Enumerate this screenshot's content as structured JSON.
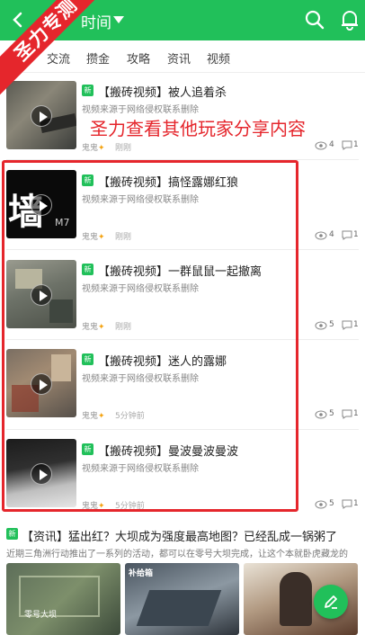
{
  "header": {
    "title": "时间"
  },
  "badge": {
    "text": "圣力专测"
  },
  "tabs": [
    {
      "label": "交流"
    },
    {
      "label": "攒金"
    },
    {
      "label": "攻略"
    },
    {
      "label": "资讯"
    },
    {
      "label": "视频"
    }
  ],
  "overlay": {
    "text": "圣力查看其他玩家分享内容"
  },
  "posts": [
    {
      "tag": "新",
      "title": "【搬砖视频】被人追着杀",
      "desc": "视频来源于网络侵权联系删除",
      "author": "鬼鬼",
      "time": "刚刚",
      "views": "4",
      "comments": "1"
    },
    {
      "tag": "新",
      "title": "【搬砖视频】搞怪露娜红狼",
      "desc": "视频来源于网络侵权联系删除",
      "author": "鬼鬼",
      "time": "刚刚",
      "views": "4",
      "comments": "1",
      "thumb_text": "墙",
      "thumb_text2": "M7"
    },
    {
      "tag": "新",
      "title": "【搬砖视频】一群鼠鼠一起撤离",
      "desc": "视频来源于网络侵权联系删除",
      "author": "鬼鬼",
      "time": "刚刚",
      "views": "5",
      "comments": "1"
    },
    {
      "tag": "新",
      "title": "【搬砖视频】迷人的露娜",
      "desc": "视频来源于网络侵权联系删除",
      "author": "鬼鬼",
      "time": "5分钟前",
      "views": "5",
      "comments": "1"
    },
    {
      "tag": "新",
      "title": "【搬砖视频】曼波曼波曼波",
      "desc": "视频来源于网络侵权联系删除",
      "author": "鬼鬼",
      "time": "5分钟前",
      "views": "5",
      "comments": "1"
    }
  ],
  "news": {
    "tag": "新",
    "title": "【资讯】猛出红？大坝成为强度最高地图？已经乱成一锅粥了",
    "desc": "近期三角洲行动推出了一系列的活动，都可以在零号大坝完成，让这个本就卧虎藏龙的",
    "img1_caption": "零号大坝",
    "img2_caption": "补给箱"
  },
  "colors": {
    "brand": "#21c05a",
    "highlight": "#e5262c"
  },
  "icons": [
    "back-icon",
    "caret-down-icon",
    "search-icon",
    "bell-icon",
    "play-icon",
    "eye-icon",
    "comment-icon",
    "edit-icon"
  ]
}
